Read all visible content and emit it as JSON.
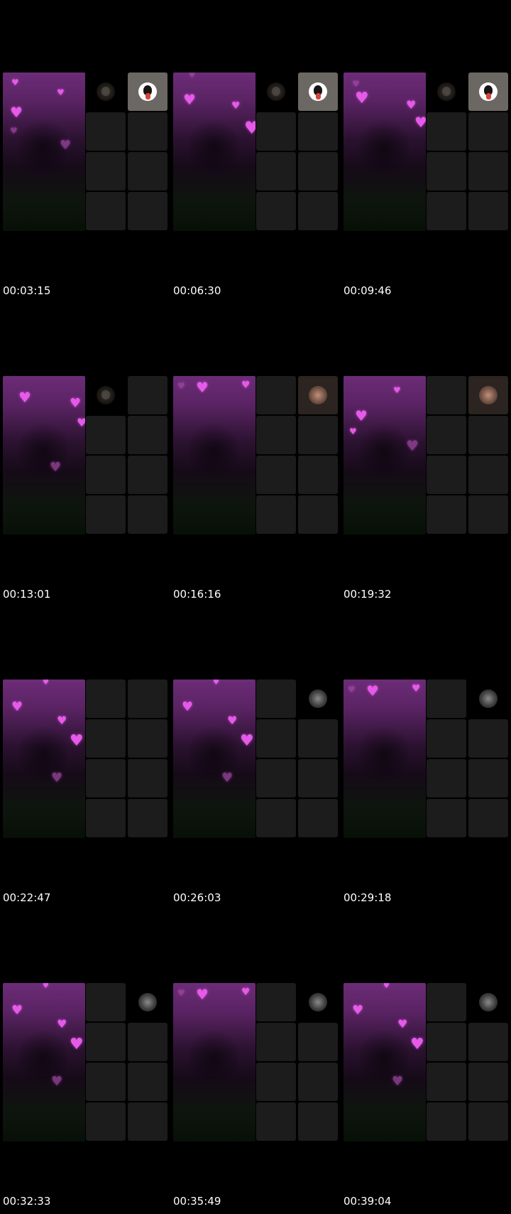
{
  "frames": [
    {
      "timestamp": "00:03:15",
      "tiles": [
        "dark",
        "girl",
        "blank",
        "blank",
        "blank",
        "blank",
        "blank",
        "blank"
      ]
    },
    {
      "timestamp": "00:06:30",
      "tiles": [
        "dark",
        "girl",
        "blank",
        "blank",
        "blank",
        "blank",
        "blank",
        "blank"
      ]
    },
    {
      "timestamp": "00:09:46",
      "tiles": [
        "dark",
        "girl",
        "blank",
        "blank",
        "blank",
        "blank",
        "blank",
        "blank"
      ]
    },
    {
      "timestamp": "00:13:01",
      "tiles": [
        "dark",
        "blank",
        "blank",
        "blank",
        "blank",
        "blank",
        "blank",
        "blank"
      ]
    },
    {
      "timestamp": "00:16:16",
      "tiles": [
        "blank",
        "floral",
        "blank",
        "blank",
        "blank",
        "blank",
        "blank",
        "blank"
      ]
    },
    {
      "timestamp": "00:19:32",
      "tiles": [
        "blank",
        "floral",
        "blank",
        "blank",
        "blank",
        "blank",
        "blank",
        "blank"
      ]
    },
    {
      "timestamp": "00:22:47",
      "tiles": [
        "blank",
        "blank",
        "blank",
        "blank",
        "blank",
        "blank",
        "blank",
        "blank"
      ]
    },
    {
      "timestamp": "00:26:03",
      "tiles": [
        "blank",
        "grey",
        "blank",
        "blank",
        "blank",
        "blank",
        "blank",
        "blank"
      ]
    },
    {
      "timestamp": "00:29:18",
      "tiles": [
        "blank",
        "grey",
        "blank",
        "blank",
        "blank",
        "blank",
        "blank",
        "blank"
      ]
    },
    {
      "timestamp": "00:32:33",
      "tiles": [
        "blank",
        "grey",
        "blank",
        "blank",
        "blank",
        "blank",
        "blank",
        "blank"
      ]
    },
    {
      "timestamp": "00:35:49",
      "tiles": [
        "blank",
        "grey",
        "blank",
        "blank",
        "blank",
        "blank",
        "blank",
        "blank"
      ]
    },
    {
      "timestamp": "00:39:04",
      "tiles": [
        "blank",
        "grey",
        "blank",
        "blank",
        "blank",
        "blank",
        "blank",
        "blank"
      ]
    }
  ],
  "icons": {
    "floating_effect": "heart-icon"
  },
  "colors": {
    "background": "#000000",
    "heart": "#e55ae8",
    "tile": "#1c1c1c",
    "timestamp": "#ffffff"
  }
}
